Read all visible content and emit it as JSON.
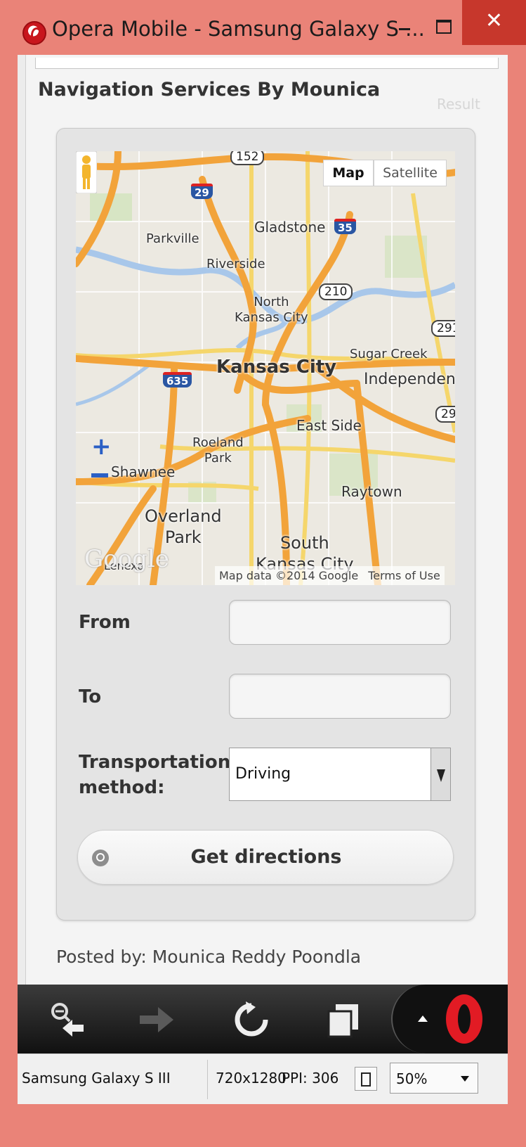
{
  "window": {
    "title": "Opera Mobile - Samsung Galaxy S ...",
    "close_glyph": "✕"
  },
  "page": {
    "title": "Navigation Services By Mounica",
    "result_label": "Result"
  },
  "map": {
    "type_buttons": {
      "map": "Map",
      "satellite": "Satellite"
    },
    "attribution": "Map data ©2014 Google",
    "terms": "Terms of Use",
    "logo": "Google",
    "places": {
      "gladstone": "Gladstone",
      "parkville": "Parkville",
      "riverside": "Riverside",
      "north_kc": "North\nKansas City",
      "kansas_city": "Kansas City",
      "sugar_creek": "Sugar Creek",
      "independence": "Independenc",
      "east_side": "East Side",
      "roeland_park": "Roeland\nPark",
      "shawnee": "Shawnee",
      "raytown": "Raytown",
      "overland_park": "Overland\nPark",
      "south_kc": "South\nKansas City",
      "lenexa": "Lenexa"
    },
    "shields": {
      "i29": "29",
      "i35": "35",
      "i635": "635",
      "r152": "152",
      "r210": "210",
      "r291": "291",
      "r29b": "29"
    }
  },
  "form": {
    "from_label": "From",
    "from_value": "",
    "to_label": "To",
    "to_value": "",
    "transport_label": "Transportation method:",
    "transport_value": "Driving",
    "submit_label": "Get directions"
  },
  "footer": {
    "posted_by": "Posted by: Mounica Reddy Poondla"
  },
  "statusbar": {
    "device": "Samsung Galaxy S III",
    "resolution": "720x1280",
    "ppi": "PPI: 306",
    "zoom": "50%"
  }
}
